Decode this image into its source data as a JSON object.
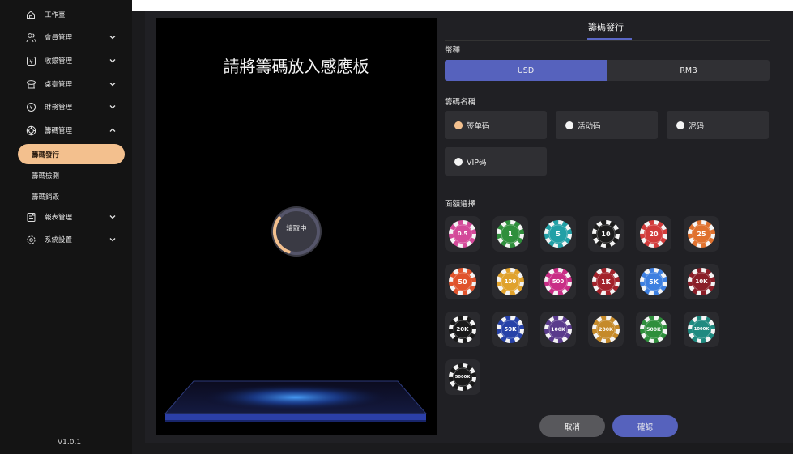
{
  "sidebar": {
    "items": [
      {
        "label": "工作臺",
        "icon": "home-icon"
      },
      {
        "label": "會員管理",
        "icon": "users-icon"
      },
      {
        "label": "收銀管理",
        "icon": "cashier-icon"
      },
      {
        "label": "桌臺管理",
        "icon": "table-icon"
      },
      {
        "label": "財務管理",
        "icon": "finance-icon"
      },
      {
        "label": "籌碼管理",
        "icon": "chip-icon"
      },
      {
        "label": "報表管理",
        "icon": "report-icon"
      },
      {
        "label": "系統設置",
        "icon": "settings-icon"
      }
    ],
    "sub_items": [
      "籌碼發行",
      "籌碼檢測",
      "籌碼銷毀"
    ],
    "version": "V1.0.1"
  },
  "reader": {
    "title": "請將籌碼放入感應板",
    "status": "讀取中",
    "progress": 0.3
  },
  "form": {
    "tab": "籌碼發行",
    "currency_label": "幣種",
    "currencies": [
      "USD",
      "RMB"
    ],
    "selected_currency": "USD",
    "chip_name_label": "籌碼名稱",
    "chip_types": [
      "签单码",
      "活动码",
      "泥码",
      "VIP码"
    ],
    "selected_chip_type": "签单码",
    "denomination_label": "面額選擇",
    "denominations": [
      {
        "label": "0.5",
        "color": "#d44a9a"
      },
      {
        "label": "1",
        "color": "#2f8f3c"
      },
      {
        "label": "5",
        "color": "#22a0a6"
      },
      {
        "label": "10",
        "color": "#1c1c1c"
      },
      {
        "label": "20",
        "color": "#d23b3b"
      },
      {
        "label": "25",
        "color": "#e0722f"
      },
      {
        "label": "50",
        "color": "#e0532c"
      },
      {
        "label": "100",
        "color": "#e0a22c"
      },
      {
        "label": "500",
        "color": "#c92d86"
      },
      {
        "label": "1K",
        "color": "#a3222b"
      },
      {
        "label": "5K",
        "color": "#3d7fe0"
      },
      {
        "label": "10K",
        "color": "#8a1e28"
      },
      {
        "label": "20K",
        "color": "#1a1a1a"
      },
      {
        "label": "50K",
        "color": "#2742a8"
      },
      {
        "label": "100K",
        "color": "#5a3b8c"
      },
      {
        "label": "200K",
        "color": "#c58a2a"
      },
      {
        "label": "500K",
        "color": "#2f8f3c"
      },
      {
        "label": "1000K",
        "color": "#1f8a80"
      },
      {
        "label": "5000K",
        "color": "#1a1a1a"
      }
    ],
    "cancel_label": "取消",
    "confirm_label": "確認"
  }
}
